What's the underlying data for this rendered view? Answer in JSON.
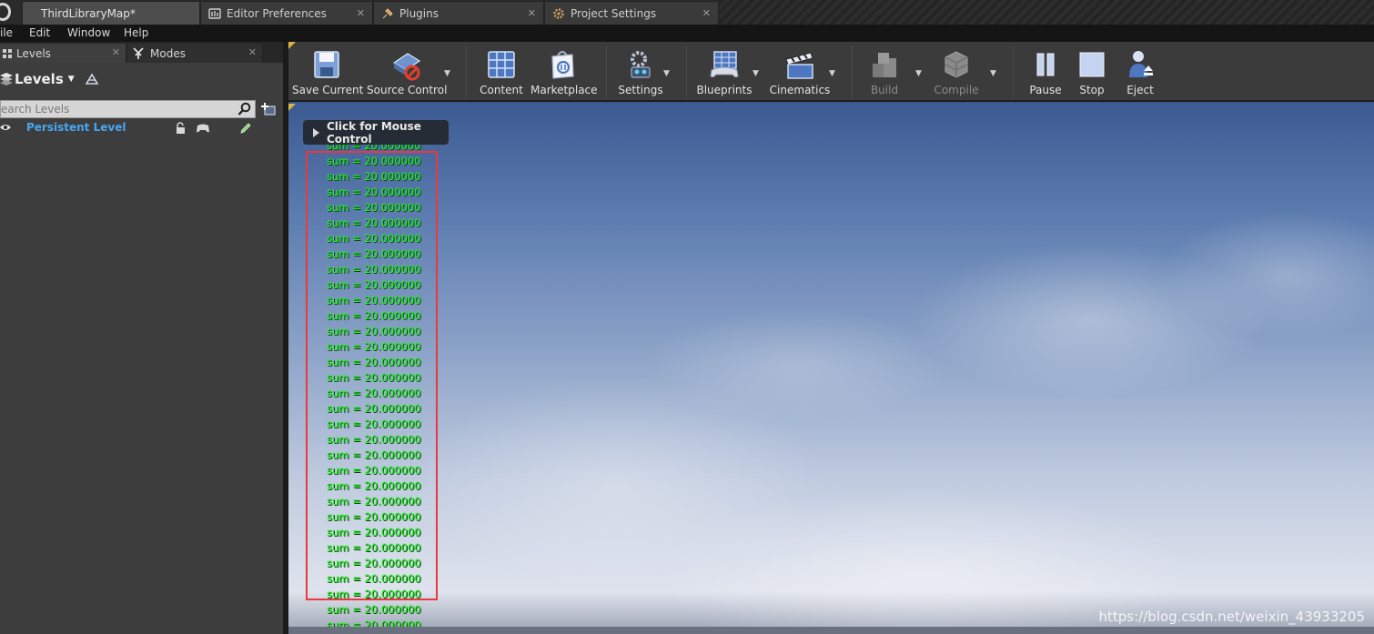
{
  "tabs": [
    {
      "label": "ThirdLibraryMap*",
      "active": true,
      "icon": "ue-logo"
    },
    {
      "label": "Editor Preferences",
      "icon": "preferences-icon"
    },
    {
      "label": "Plugins",
      "icon": "plug-icon"
    },
    {
      "label": "Project Settings",
      "icon": "settings-gear-icon"
    }
  ],
  "menu": [
    "ile",
    "Edit",
    "Window",
    "Help"
  ],
  "left_panel": {
    "tabs": [
      {
        "label": "Levels"
      },
      {
        "label": "Modes"
      }
    ],
    "heading": "Levels",
    "search_placeholder": "earch Levels",
    "persistent_level": "Persistent Level"
  },
  "toolbar": [
    {
      "label": "Save Current",
      "icon": "save-icon"
    },
    {
      "label": "Source Control",
      "icon": "source-control-icon"
    },
    {
      "label": "Content",
      "icon": "content-browser-icon"
    },
    {
      "label": "Marketplace",
      "icon": "marketplace-icon"
    },
    {
      "label": "Settings",
      "icon": "settings-icon"
    },
    {
      "label": "Blueprints",
      "icon": "blueprints-icon"
    },
    {
      "label": "Cinematics",
      "icon": "cinematics-icon"
    },
    {
      "label": "Build",
      "icon": "build-icon",
      "disabled": true
    },
    {
      "label": "Compile",
      "icon": "compile-icon",
      "disabled": true
    },
    {
      "label": "Pause",
      "icon": "pause-icon"
    },
    {
      "label": "Stop",
      "icon": "stop-icon"
    },
    {
      "label": "Eject",
      "icon": "eject-icon"
    }
  ],
  "viewport": {
    "mouse_control_label": "Click for Mouse Control",
    "log_text": "sum = 20.000000",
    "log_count": 32,
    "watermark": "https://blog.csdn.net/weixin_43933205"
  },
  "colors": {
    "log_green": "#19ff19",
    "highlight_red": "#e8393e",
    "level_blue": "#46a7f0"
  }
}
